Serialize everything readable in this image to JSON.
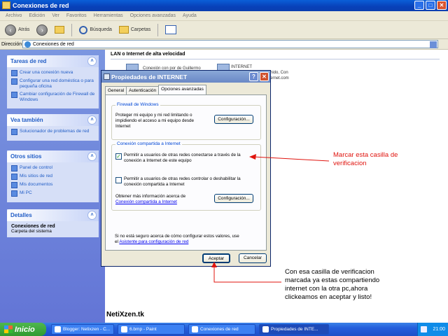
{
  "window": {
    "title": "Conexiones de red"
  },
  "menu": [
    "Archivo",
    "Edición",
    "Ver",
    "Favoritos",
    "Herramientas",
    "Opciones avanzadas",
    "Ayuda"
  ],
  "toolbar": {
    "back": "Atrás",
    "search": "Búsqueda",
    "folders": "Carpetas"
  },
  "address": {
    "label": "Dirección",
    "value": "Conexiones de red"
  },
  "sidebar": {
    "tareas": {
      "title": "Tareas de red",
      "items": [
        "Crear una conexión nueva",
        "Configurar una red doméstica o para pequeña oficina",
        "Cambiar configuración de Firewall de Windows"
      ]
    },
    "vea": {
      "title": "Vea también",
      "items": [
        "Solucionador de problemas de red"
      ]
    },
    "otros": {
      "title": "Otros sitios",
      "items": [
        "Panel de control",
        "Mis sitios de red",
        "Mis documentos",
        "Mi PC"
      ]
    },
    "detalles": {
      "title": "Detalles",
      "name": "Conexiones de red",
      "sub": "Carpeta del sistema"
    }
  },
  "content": {
    "section": "LAN o Internet de alta velocidad",
    "item1": "Conexión con por de Guillermo",
    "item2": "INTERNET",
    "item2_sub1": "hido, Con",
    "item2_sub2": "ernet.com",
    "watermark": "NetiXzen.tk"
  },
  "dialog": {
    "title": "Propiedades de INTERNET",
    "tabs": [
      "General",
      "Autenticación",
      "Opciones avanzadas"
    ],
    "firewall": {
      "label": "Firewall de Windows",
      "text": "Proteger mi equipo y mi red limitando o impidiendo el acceso a mi equipo desde Internet",
      "button": "Configuración..."
    },
    "ics": {
      "label": "Conexión compartida a Internet",
      "check1": "Permitir a usuarios de otras redes conectarse a través de la conexión a Internet de este equipo",
      "check2": "Permitir a usuarios de otras redes controlar o deshabilitar la conexión compartida a Internet",
      "info": "Obtener más información acerca de",
      "link": "Conexión compartida a Internet",
      "button": "Configuración..."
    },
    "footer_text": "Si no está seguro acerca de cómo configurar estos valores, use el",
    "footer_link": "Asistente para configuración de red",
    "ok": "Aceptar",
    "cancel": "Cancelar"
  },
  "annotations": {
    "note1": "Marcar esta casilla de verificacion",
    "note2": "Con esa casilla de verificacion marcada ya estas compartiendo internet con la otra pc,ahora clickeamos en aceptar y listo!"
  },
  "taskbar": {
    "start": "Inicio",
    "buttons": [
      "Blogger: Netixzen - C...",
      "6.bmp - Paint",
      "Conexiones de red",
      "Propiedades de INTE..."
    ],
    "clock": "21:00"
  }
}
